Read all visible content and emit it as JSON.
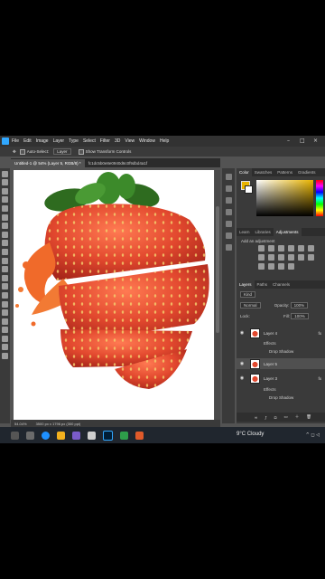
{
  "menu": {
    "items": [
      "File",
      "Edit",
      "Image",
      "Layer",
      "Type",
      "Select",
      "Filter",
      "3D",
      "View",
      "Window",
      "Help"
    ],
    "window_controls": [
      "–",
      "□",
      "×"
    ]
  },
  "options_bar": {
    "auto_select_label": "Auto-Select:",
    "auto_select_target": "Layer",
    "show_transform_label": "Show Transform Controls"
  },
  "tabs": [
    {
      "label": "Untitled-1 @ 54% (Layer 5, RGB/8) *"
    },
    {
      "label": "fc1dc5b0e8e0940d6c0f9dbd4a1f"
    }
  ],
  "status": {
    "zoom": "54.04%",
    "doc_size": "3500 px x 1796 px (300 ppi)"
  },
  "color_panel": {
    "tabs": [
      "Color",
      "Swatches",
      "Patterns",
      "Gradients"
    ],
    "foreground": "#e8b400",
    "background": "#ffffff"
  },
  "adjust_panel": {
    "tabs": [
      "Learn",
      "Libraries",
      "Adjustments"
    ],
    "add_label": "Add an adjustment"
  },
  "layers_panel": {
    "tabs": [
      "Layers",
      "Paths",
      "Channels"
    ],
    "kind_label": "Kind",
    "blend_mode": "Normal",
    "opacity_label": "Opacity:",
    "opacity_value": "100%",
    "lock_label": "Lock:",
    "fill_label": "Fill:",
    "fill_value": "100%",
    "layers": [
      {
        "name": "Layer 4",
        "fx": "fx"
      },
      {
        "name": "Effects"
      },
      {
        "name": "Drop Shadow"
      },
      {
        "name": "Layer 5"
      },
      {
        "name": "Layer 3",
        "fx": "fx"
      },
      {
        "name": "Effects"
      },
      {
        "name": "Drop Shadow"
      }
    ]
  },
  "taskbar": {
    "weather": "9°C Cloudy",
    "tray": "^ ◻ ◁"
  },
  "accent_colors": {
    "photoshop_blue": "#31a8ff",
    "strawberry": "#e2482e"
  }
}
